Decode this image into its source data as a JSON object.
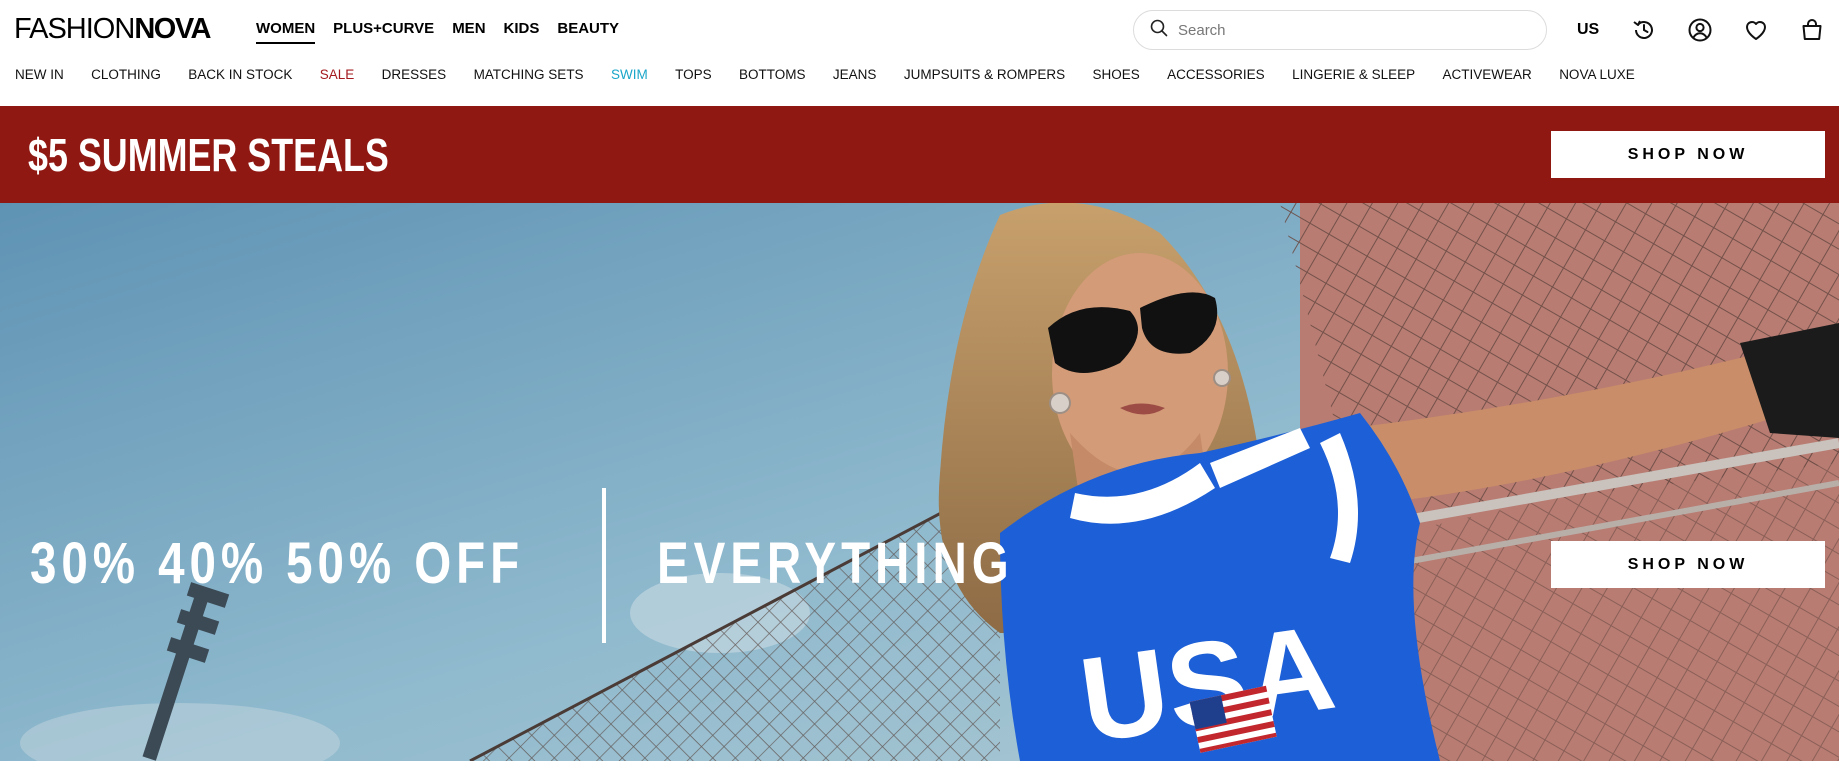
{
  "brand": {
    "logo_light": "FASHION",
    "logo_bold": "NOVA"
  },
  "dept_nav": [
    {
      "label": "WOMEN",
      "active": true
    },
    {
      "label": "PLUS+CURVE",
      "active": false
    },
    {
      "label": "MEN",
      "active": false
    },
    {
      "label": "KIDS",
      "active": false
    },
    {
      "label": "BEAUTY",
      "active": false
    }
  ],
  "search": {
    "placeholder": "Search"
  },
  "region": "US",
  "header_icons": [
    "history-icon",
    "account-icon",
    "wishlist-heart-icon",
    "shopping-bag-icon"
  ],
  "category_nav": [
    {
      "label": "NEW IN"
    },
    {
      "label": "CLOTHING"
    },
    {
      "label": "BACK IN STOCK"
    },
    {
      "label": "SALE",
      "color": "#a3191e"
    },
    {
      "label": "DRESSES"
    },
    {
      "label": "MATCHING SETS"
    },
    {
      "label": "SWIM",
      "color": "#1aa6c9"
    },
    {
      "label": "TOPS"
    },
    {
      "label": "BOTTOMS"
    },
    {
      "label": "JEANS"
    },
    {
      "label": "JUMPSUITS & ROMPERS"
    },
    {
      "label": "SHOES"
    },
    {
      "label": "ACCESSORIES"
    },
    {
      "label": "LINGERIE & SLEEP"
    },
    {
      "label": "ACTIVEWEAR"
    },
    {
      "label": "NOVA LUXE"
    }
  ],
  "promo_banner": {
    "title": "$5 SUMMER STEALS",
    "button": "SHOP NOW",
    "background": "#8f1813"
  },
  "hero": {
    "headline_left": "30% 40% 50% OFF",
    "headline_right": "EVERYTHING",
    "button": "SHOP NOW",
    "shirt_text": "USA"
  },
  "colors": {
    "shirt_blue": "#1d5fd6",
    "sale_red": "#a3191e",
    "swim_teal": "#1aa6c9"
  }
}
